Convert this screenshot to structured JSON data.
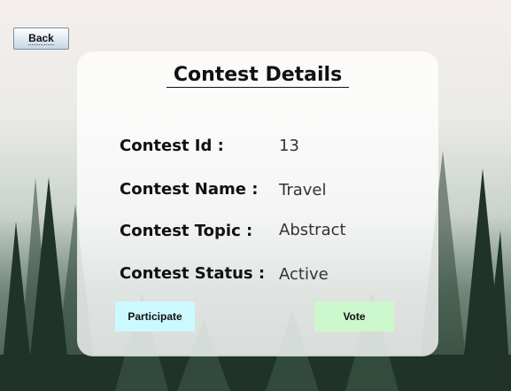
{
  "toolbar": {
    "back_label": "Back"
  },
  "card": {
    "title": "Contest Details",
    "fields": [
      {
        "label": "Contest Id :",
        "value": "13"
      },
      {
        "label": "Contest Name :",
        "value": "Travel"
      },
      {
        "label": "Contest Topic :",
        "value": "Abstract"
      },
      {
        "label": "Contest Status :",
        "value": "Active"
      }
    ],
    "buttons": {
      "participate": "Participate",
      "vote": "Vote"
    }
  },
  "colors": {
    "participate_bg": "#ccf9ff",
    "vote_bg": "#cdf7cd",
    "card_bg": "rgba(255,255,255,0.78)"
  },
  "background": {
    "image": "misty pine forest"
  }
}
